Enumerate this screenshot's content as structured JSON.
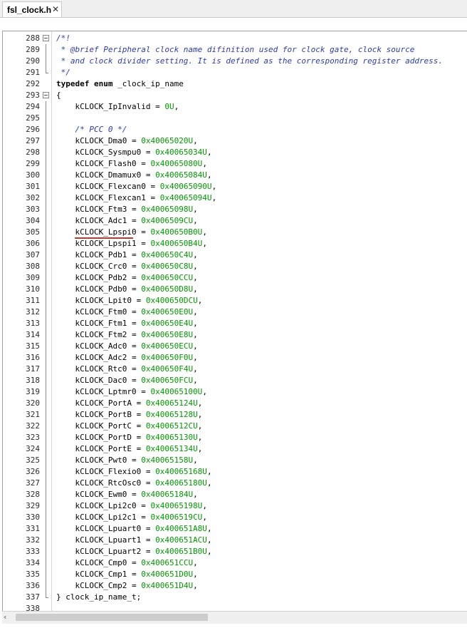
{
  "tab": {
    "label": "fsl_clock.h",
    "close": "✕"
  },
  "editor": {
    "lines": [
      {
        "n": "288",
        "fold": "start",
        "segs": [
          {
            "t": "/*!",
            "c": "cm"
          }
        ]
      },
      {
        "n": "289",
        "fold": "bar",
        "segs": [
          {
            "t": " * @brief Peripheral clock name difinition used for clock gate, clock source",
            "c": "cm"
          }
        ]
      },
      {
        "n": "290",
        "fold": "bar",
        "segs": [
          {
            "t": " * and clock divider setting. It is defined as the corresponding register address.",
            "c": "cm"
          }
        ]
      },
      {
        "n": "291",
        "fold": "end",
        "segs": [
          {
            "t": " */",
            "c": "cm"
          }
        ]
      },
      {
        "n": "292",
        "segs": [
          {
            "t": "typedef enum",
            "c": "kw"
          },
          {
            "t": " _clock_ip_name"
          }
        ]
      },
      {
        "n": "293",
        "fold": "start",
        "segs": [
          {
            "t": "{"
          }
        ]
      },
      {
        "n": "294",
        "fold": "bar",
        "segs": [
          {
            "t": "    kCLOCK_IpInvalid = "
          },
          {
            "t": "0U",
            "c": "num"
          },
          {
            "t": ","
          }
        ]
      },
      {
        "n": "295",
        "fold": "bar",
        "segs": [
          {
            "t": ""
          }
        ]
      },
      {
        "n": "296",
        "fold": "bar",
        "segs": [
          {
            "t": "    "
          },
          {
            "t": "/* PCC 0 */",
            "c": "cm"
          }
        ]
      },
      {
        "n": "297",
        "fold": "bar",
        "segs": [
          {
            "t": "    kCLOCK_Dma0 = "
          },
          {
            "t": "0x40065020U",
            "c": "num"
          },
          {
            "t": ","
          }
        ]
      },
      {
        "n": "298",
        "fold": "bar",
        "segs": [
          {
            "t": "    kCLOCK_Sysmpu0 = "
          },
          {
            "t": "0x40065034U",
            "c": "num"
          },
          {
            "t": ","
          }
        ]
      },
      {
        "n": "299",
        "fold": "bar",
        "segs": [
          {
            "t": "    kCLOCK_Flash0 = "
          },
          {
            "t": "0x40065080U",
            "c": "num"
          },
          {
            "t": ","
          }
        ]
      },
      {
        "n": "300",
        "fold": "bar",
        "segs": [
          {
            "t": "    kCLOCK_Dmamux0 = "
          },
          {
            "t": "0x40065084U",
            "c": "num"
          },
          {
            "t": ","
          }
        ]
      },
      {
        "n": "301",
        "fold": "bar",
        "segs": [
          {
            "t": "    kCLOCK_Flexcan0 = "
          },
          {
            "t": "0x40065090U",
            "c": "num"
          },
          {
            "t": ","
          }
        ]
      },
      {
        "n": "302",
        "fold": "bar",
        "segs": [
          {
            "t": "    kCLOCK_Flexcan1 = "
          },
          {
            "t": "0x40065094U",
            "c": "num"
          },
          {
            "t": ","
          }
        ]
      },
      {
        "n": "303",
        "fold": "bar",
        "segs": [
          {
            "t": "    kCLOCK_Ftm3 = "
          },
          {
            "t": "0x40065098U",
            "c": "num"
          },
          {
            "t": ","
          }
        ]
      },
      {
        "n": "304",
        "fold": "bar",
        "segs": [
          {
            "t": "    kCLOCK_Adc1 = "
          },
          {
            "t": "0x4006509CU",
            "c": "num"
          },
          {
            "t": ","
          }
        ]
      },
      {
        "n": "305",
        "fold": "bar",
        "segs": [
          {
            "t": "    kCLOCK_Lpspi0 = "
          },
          {
            "t": "0x400650B0U",
            "c": "num"
          },
          {
            "t": ","
          }
        ]
      },
      {
        "n": "306",
        "fold": "bar",
        "segs": [
          {
            "t": "    kCLOCK_Lpspi1 = "
          },
          {
            "t": "0x400650B4U",
            "c": "num"
          },
          {
            "t": ","
          }
        ]
      },
      {
        "n": "307",
        "fold": "bar",
        "segs": [
          {
            "t": "    kCLOCK_Pdb1 = "
          },
          {
            "t": "0x400650C4U",
            "c": "num"
          },
          {
            "t": ","
          }
        ]
      },
      {
        "n": "308",
        "fold": "bar",
        "segs": [
          {
            "t": "    kCLOCK_Crc0 = "
          },
          {
            "t": "0x400650C8U",
            "c": "num"
          },
          {
            "t": ","
          }
        ]
      },
      {
        "n": "309",
        "fold": "bar",
        "segs": [
          {
            "t": "    kCLOCK_Pdb2 = "
          },
          {
            "t": "0x400650CCU",
            "c": "num"
          },
          {
            "t": ","
          }
        ]
      },
      {
        "n": "310",
        "fold": "bar",
        "segs": [
          {
            "t": "    kCLOCK_Pdb0 = "
          },
          {
            "t": "0x400650D8U",
            "c": "num"
          },
          {
            "t": ","
          }
        ]
      },
      {
        "n": "311",
        "fold": "bar",
        "segs": [
          {
            "t": "    kCLOCK_Lpit0 = "
          },
          {
            "t": "0x400650DCU",
            "c": "num"
          },
          {
            "t": ","
          }
        ]
      },
      {
        "n": "312",
        "fold": "bar",
        "segs": [
          {
            "t": "    kCLOCK_Ftm0 = "
          },
          {
            "t": "0x400650E0U",
            "c": "num"
          },
          {
            "t": ","
          }
        ]
      },
      {
        "n": "313",
        "fold": "bar",
        "segs": [
          {
            "t": "    kCLOCK_Ftm1 = "
          },
          {
            "t": "0x400650E4U",
            "c": "num"
          },
          {
            "t": ","
          }
        ]
      },
      {
        "n": "314",
        "fold": "bar",
        "segs": [
          {
            "t": "    kCLOCK_Ftm2 = "
          },
          {
            "t": "0x400650E8U",
            "c": "num"
          },
          {
            "t": ","
          }
        ]
      },
      {
        "n": "315",
        "fold": "bar",
        "segs": [
          {
            "t": "    kCLOCK_Adc0 = "
          },
          {
            "t": "0x400650ECU",
            "c": "num"
          },
          {
            "t": ","
          }
        ]
      },
      {
        "n": "316",
        "fold": "bar",
        "segs": [
          {
            "t": "    kCLOCK_Adc2 = "
          },
          {
            "t": "0x400650F0U",
            "c": "num"
          },
          {
            "t": ","
          }
        ]
      },
      {
        "n": "317",
        "fold": "bar",
        "segs": [
          {
            "t": "    kCLOCK_Rtc0 = "
          },
          {
            "t": "0x400650F4U",
            "c": "num"
          },
          {
            "t": ","
          }
        ]
      },
      {
        "n": "318",
        "fold": "bar",
        "segs": [
          {
            "t": "    kCLOCK_Dac0 = "
          },
          {
            "t": "0x400650FCU",
            "c": "num"
          },
          {
            "t": ","
          }
        ]
      },
      {
        "n": "319",
        "fold": "bar",
        "segs": [
          {
            "t": "    kCLOCK_Lptmr0 = "
          },
          {
            "t": "0x40065100U",
            "c": "num"
          },
          {
            "t": ","
          }
        ]
      },
      {
        "n": "320",
        "fold": "bar",
        "segs": [
          {
            "t": "    kCLOCK_PortA = "
          },
          {
            "t": "0x40065124U",
            "c": "num"
          },
          {
            "t": ","
          }
        ]
      },
      {
        "n": "321",
        "fold": "bar",
        "segs": [
          {
            "t": "    kCLOCK_PortB = "
          },
          {
            "t": "0x40065128U",
            "c": "num"
          },
          {
            "t": ","
          }
        ]
      },
      {
        "n": "322",
        "fold": "bar",
        "segs": [
          {
            "t": "    kCLOCK_PortC = "
          },
          {
            "t": "0x4006512CU",
            "c": "num"
          },
          {
            "t": ","
          }
        ]
      },
      {
        "n": "323",
        "fold": "bar",
        "segs": [
          {
            "t": "    kCLOCK_PortD = "
          },
          {
            "t": "0x40065130U",
            "c": "num"
          },
          {
            "t": ","
          }
        ]
      },
      {
        "n": "324",
        "fold": "bar",
        "segs": [
          {
            "t": "    kCLOCK_PortE = "
          },
          {
            "t": "0x40065134U",
            "c": "num"
          },
          {
            "t": ","
          }
        ]
      },
      {
        "n": "325",
        "fold": "bar",
        "segs": [
          {
            "t": "    kCLOCK_Pwt0 = "
          },
          {
            "t": "0x40065158U",
            "c": "num"
          },
          {
            "t": ","
          }
        ]
      },
      {
        "n": "326",
        "fold": "bar",
        "segs": [
          {
            "t": "    kCLOCK_Flexio0 = "
          },
          {
            "t": "0x40065168U",
            "c": "num"
          },
          {
            "t": ","
          }
        ]
      },
      {
        "n": "327",
        "fold": "bar",
        "segs": [
          {
            "t": "    kCLOCK_RtcOsc0 = "
          },
          {
            "t": "0x40065180U",
            "c": "num"
          },
          {
            "t": ","
          }
        ]
      },
      {
        "n": "328",
        "fold": "bar",
        "segs": [
          {
            "t": "    kCLOCK_Ewm0 = "
          },
          {
            "t": "0x40065184U",
            "c": "num"
          },
          {
            "t": ","
          }
        ]
      },
      {
        "n": "329",
        "fold": "bar",
        "segs": [
          {
            "t": "    kCLOCK_Lpi2c0 = "
          },
          {
            "t": "0x40065198U",
            "c": "num"
          },
          {
            "t": ","
          }
        ]
      },
      {
        "n": "330",
        "fold": "bar",
        "segs": [
          {
            "t": "    kCLOCK_Lpi2c1 = "
          },
          {
            "t": "0x4006519CU",
            "c": "num"
          },
          {
            "t": ","
          }
        ]
      },
      {
        "n": "331",
        "fold": "bar",
        "segs": [
          {
            "t": "    kCLOCK_Lpuart0 = "
          },
          {
            "t": "0x400651A8U",
            "c": "num"
          },
          {
            "t": ","
          }
        ]
      },
      {
        "n": "332",
        "fold": "bar",
        "segs": [
          {
            "t": "    kCLOCK_Lpuart1 = "
          },
          {
            "t": "0x400651ACU",
            "c": "num"
          },
          {
            "t": ","
          }
        ]
      },
      {
        "n": "333",
        "fold": "bar",
        "segs": [
          {
            "t": "    kCLOCK_Lpuart2 = "
          },
          {
            "t": "0x400651B0U",
            "c": "num"
          },
          {
            "t": ","
          }
        ]
      },
      {
        "n": "334",
        "fold": "bar",
        "segs": [
          {
            "t": "    kCLOCK_Cmp0 = "
          },
          {
            "t": "0x400651CCU",
            "c": "num"
          },
          {
            "t": ","
          }
        ]
      },
      {
        "n": "335",
        "fold": "bar",
        "segs": [
          {
            "t": "    kCLOCK_Cmp1 = "
          },
          {
            "t": "0x400651D0U",
            "c": "num"
          },
          {
            "t": ","
          }
        ]
      },
      {
        "n": "336",
        "fold": "bar",
        "segs": [
          {
            "t": "    kCLOCK_Cmp2 = "
          },
          {
            "t": "0x400651D4U",
            "c": "num"
          },
          {
            "t": ","
          }
        ]
      },
      {
        "n": "337",
        "fold": "end",
        "segs": [
          {
            "t": "} clock_ip_name_t;"
          }
        ]
      },
      {
        "n": "338",
        "segs": [
          {
            "t": ""
          }
        ]
      }
    ]
  },
  "colors": {
    "comment": "#2b3bb0",
    "number": "#009900",
    "underline": "#c0392b"
  },
  "scrollbar": {
    "left_icon": "chevron-left-icon"
  }
}
